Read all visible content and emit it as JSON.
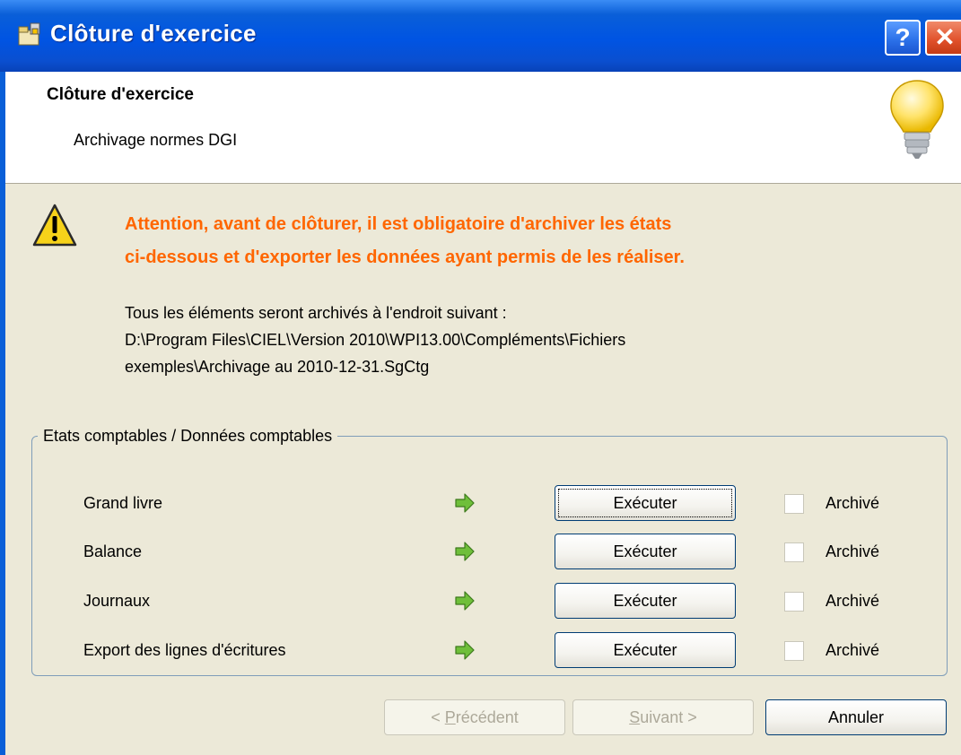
{
  "window": {
    "title": "Clôture d'exercice",
    "help_label": "?",
    "close_label": "✕"
  },
  "header": {
    "title": "Clôture d'exercice",
    "subtitle": "Archivage normes DGI",
    "icon": "lightbulb-icon"
  },
  "warning": {
    "icon": "warning-icon",
    "lines": [
      "Attention, avant de clôturer, il est obligatoire d'archiver les états",
      "ci-dessous et d'exporter les données ayant permis de les réaliser."
    ],
    "color": "#ff6600"
  },
  "info": {
    "lines": [
      "Tous les éléments seront archivés à l'endroit suivant :",
      "D:\\Program Files\\CIEL\\Version 2010\\WPI13.00\\Compléments\\Fichiers",
      "exemples\\Archivage au 2010-12-31.SgCtg"
    ]
  },
  "group": {
    "legend": "Etats comptables / Données comptables",
    "rows": [
      {
        "label": "Grand livre",
        "button": "Exécuter",
        "checkbox_label": "Archivé",
        "checked": false
      },
      {
        "label": "Balance",
        "button": "Exécuter",
        "checkbox_label": "Archivé",
        "checked": false
      },
      {
        "label": "Journaux",
        "button": "Exécuter",
        "checkbox_label": "Archivé",
        "checked": false
      },
      {
        "label": "Export des lignes d'écritures",
        "button": "Exécuter",
        "checkbox_label": "Archivé",
        "checked": false
      }
    ]
  },
  "footer": {
    "prev": {
      "pre": "< ",
      "accel": "P",
      "post": "récédent"
    },
    "next": {
      "accel": "S",
      "post": "uivant >"
    },
    "cancel": "Annuler"
  }
}
